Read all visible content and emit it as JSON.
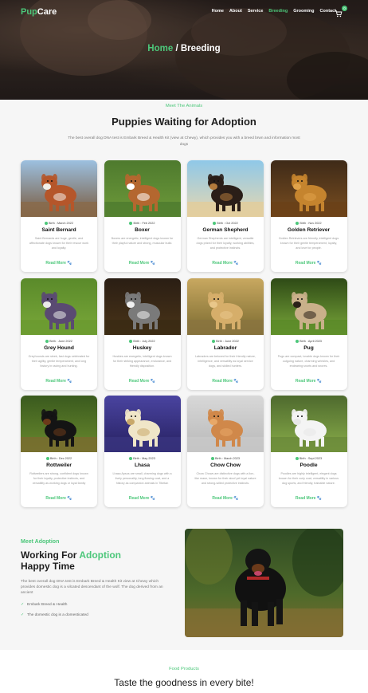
{
  "brand": {
    "pre": "Pup",
    "post": "Care"
  },
  "nav": {
    "items": [
      "Home",
      "About",
      "Service",
      "Breeding",
      "Grooming",
      "Contact"
    ],
    "active": "Breeding",
    "cart_count": "0"
  },
  "breadcrumb": {
    "home": "Home",
    "sep": " / ",
    "current": "Breeding"
  },
  "animals": {
    "kicker": "Meet The Animals",
    "title": "Puppies Waiting for Adoption",
    "desc": "The best overall dog DNA test is Embark Breed & Health Kit (view at Chewy), which provides you with a breed brwn and information most dogs",
    "cards": [
      {
        "name": "Saint Bernard",
        "birth": "Birth : March 2022",
        "bio": "Saint Bernards are huge, gentle, and affectionate dogs known for their rescue work and loyalty.",
        "more": "Read More",
        "img": "saint-bernard"
      },
      {
        "name": "Boxer",
        "birth": "Birth : Feb 2022",
        "bio": "Boxers are energetic, intelligent dogs known for their playful nature and strong, muscular build.",
        "more": "Read More",
        "img": "boxer"
      },
      {
        "name": "German Shepherd",
        "birth": "Birth : Oct 2022",
        "bio": "German Shepherds are intelligent, versatile dogs prized for their loyalty, working abilities, and protective instincts.",
        "more": "Read More",
        "img": "german-shepherd"
      },
      {
        "name": "Golden Retriever",
        "birth": "Birth : Nov 2022",
        "bio": "Golden Retrievers are friendly, intelligent dogs known for their gentle temperament, loyalty, and love for people.",
        "more": "Read More",
        "img": "golden-retriever"
      },
      {
        "name": "Grey Hound",
        "birth": "Birth : June 2022",
        "bio": "Greyhounds are sleek, fast dogs celebrated for their agility, gentle temperament, and long history in racing and hunting.",
        "more": "Read More",
        "img": "grey-hound"
      },
      {
        "name": "Huskey",
        "birth": "Birth : July 2022",
        "bio": "Huskies are energetic, intelligent dogs known for their striking appearance, endurance, and friendly disposition.",
        "more": "Read More",
        "img": "huskey"
      },
      {
        "name": "Labrador",
        "birth": "Birth : June 2022",
        "bio": "Labradors are beloved for their friendly nature, intelligence, and versatility as loyal service dogs, and skilled hunters.",
        "more": "Read More",
        "img": "labrador"
      },
      {
        "name": "Pug",
        "birth": "Birth : April 2023",
        "bio": "Pugs are compact, lovable dogs known for their outgoing nature, charming wrinkles, and endearing snorts and snores.",
        "more": "Read More",
        "img": "pug"
      },
      {
        "name": "Rottweiler",
        "birth": "Birth : Dec 2022",
        "bio": "Rottweilers are strong, confident dogs known for their loyalty, protective instincts, and versatility as working dogs or loyal family companions.",
        "more": "Read More",
        "img": "rottweiler"
      },
      {
        "name": "Lhasa",
        "birth": "Birth : May 2023",
        "bio": "Lhasa Apsos are small, charming dogs with a lively personality, long flowing coat, and a history as companion animals in Tibetan monks.",
        "more": "Read More",
        "img": "lhasa"
      },
      {
        "name": "Chow Chow",
        "birth": "Birth : March 2023",
        "bio": "Chow Chows are distinctive dogs with a lion-like mane, known for their aloof yet loyal nature and strong-willed protective instincts.",
        "more": "Read More",
        "img": "chow-chow"
      },
      {
        "name": "Poodle",
        "birth": "Birth : Sept 2023",
        "bio": "Poodles are highly intelligent, elegant dogs known for their curly coat, versatility in various dog sports, and friendly, trainable nature.",
        "more": "Read More",
        "img": "poodle"
      }
    ]
  },
  "adoption": {
    "kicker": "Meet Adoption",
    "title_a": "Working For ",
    "title_b": "Adoption",
    "title_c": "Happy Time",
    "text": "The best overall dog DNA test is Embark Breed & Health Kit view at Chewy which provides domestic dog is a vilcated descendant of the wolf. The dog derived from an ancient",
    "bullets": [
      "Embark Breed & Health",
      "The domestic dog is a domesticated"
    ]
  },
  "food": {
    "kicker": "Food Products",
    "title": "Taste the goodness in every bite!"
  },
  "colors": {
    "accent": "#4cc77a",
    "bg": "#f6f6f6"
  }
}
